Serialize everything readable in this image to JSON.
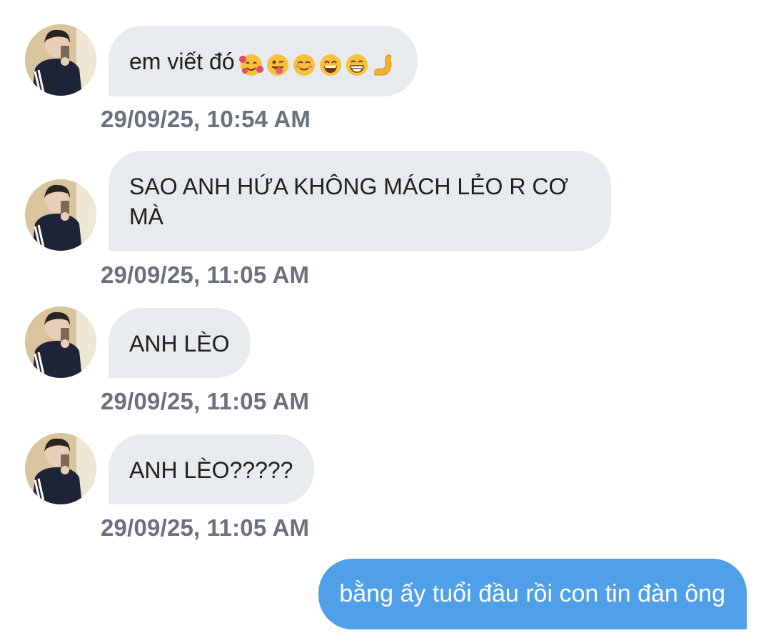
{
  "messages": [
    {
      "sender": "other",
      "text": "em viết đó",
      "emojis": [
        "smiling-face-with-hearts-icon",
        "winking-face-with-tongue-icon",
        "smiling-face-icon",
        "grinning-face-icon",
        "beaming-face-icon",
        "flexed-biceps-icon"
      ],
      "timestamp": "29/09/25, 10:54 AM"
    },
    {
      "sender": "other",
      "text_line1": "SAO ANH HỨA KHÔNG MÁCH LẺO R CƠ",
      "text_line2": "MÀ",
      "timestamp": "29/09/25, 11:05 AM"
    },
    {
      "sender": "other",
      "text": "ANH LÈO",
      "timestamp": "29/09/25, 11:05 AM"
    },
    {
      "sender": "other",
      "text": "ANH LÈO?????",
      "timestamp": "29/09/25, 11:05 AM"
    },
    {
      "sender": "me",
      "text": "bằng ấy tuổi đầu rồi con tin đàn ông"
    }
  ],
  "colors": {
    "incoming_bubble": "#e7ebee",
    "outgoing_bubble": "#4f9fe9",
    "timestamp": "#68717c"
  }
}
